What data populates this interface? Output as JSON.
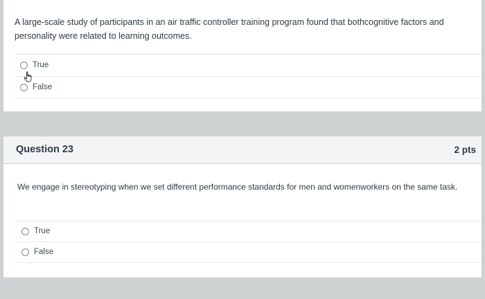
{
  "question22": {
    "text": "A large-scale study of participants in an air traffic controller training program found that bothcognitive factors and personality were related to learning outcomes.",
    "options": [
      {
        "label": "True"
      },
      {
        "label": "False"
      }
    ]
  },
  "question23": {
    "title": "Question 23",
    "points": "2 pts",
    "text": "We engage in stereotyping when we set different performance standards for men and womenworkers on the same task.",
    "options": [
      {
        "label": "True"
      },
      {
        "label": "False"
      }
    ]
  },
  "colors": {
    "background": "#cfd2d3",
    "card": "#ffffff",
    "header": "#f3f4f5",
    "text": "#2d3b45",
    "border": "#c7cdd1"
  },
  "icons": {
    "cursor": "hand-pointer-icon",
    "radio": "radio-button-icon"
  }
}
